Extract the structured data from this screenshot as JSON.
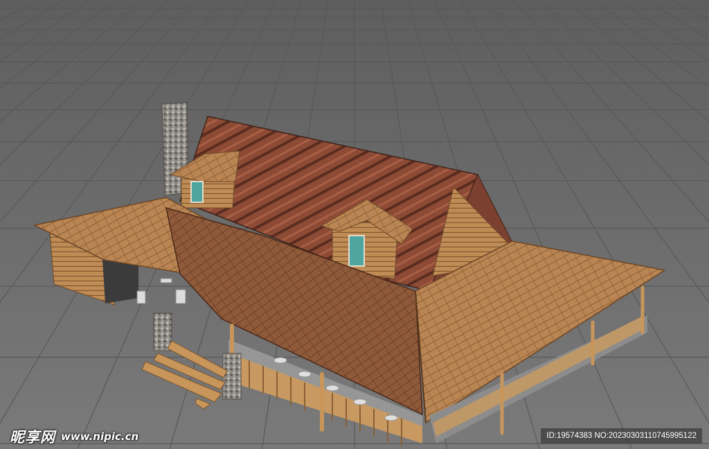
{
  "watermark": {
    "site_name": "昵享网",
    "url": "www.nipic.cn",
    "id_text": "ID:19574383 NO:20230303110745995122"
  },
  "colors": {
    "viewport_background": "#6f6f6f",
    "grid_line": "#5a5a5a",
    "roof_red": "#8a4a35",
    "roof_wood": "#b8834f",
    "log_wall": "#c08c55",
    "stone": "#8d8a84",
    "window_teal": "#4fa6a0"
  },
  "scene": {
    "subject": "3d-log-cabin-model",
    "view": "3d-viewport-perspective-grid"
  }
}
